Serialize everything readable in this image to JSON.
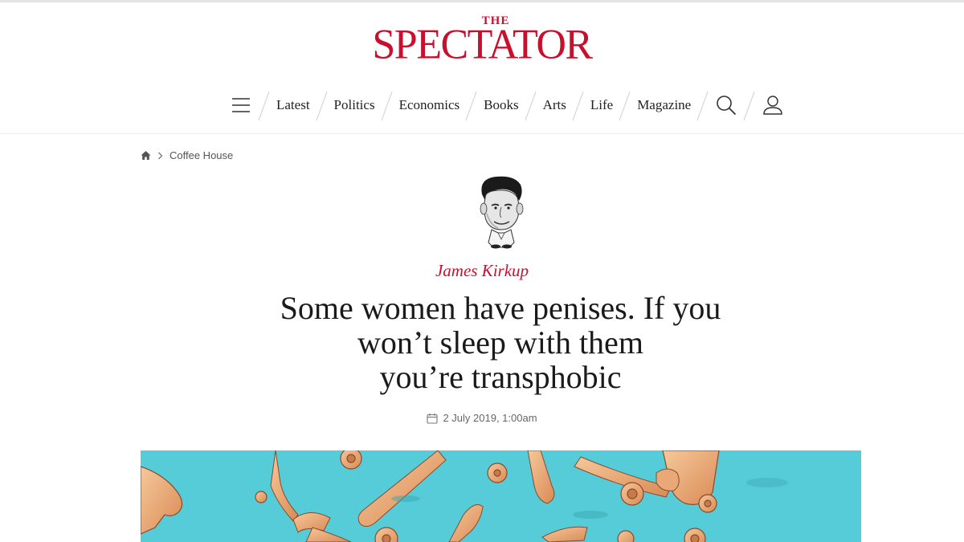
{
  "brand": {
    "logo_small": "THE",
    "logo_name": "SPECTATOR",
    "accent": "#c8102e"
  },
  "nav": {
    "menu_icon": "hamburger-menu-icon",
    "items": [
      "Latest",
      "Politics",
      "Economics",
      "Books",
      "Arts",
      "Life",
      "Magazine"
    ],
    "search_icon": "search-icon",
    "account_icon": "user-account-icon"
  },
  "breadcrumb": {
    "home_icon": "home-icon",
    "separator_icon": "chevron-right-icon",
    "section": "Coffee House"
  },
  "article": {
    "author": "James Kirkup",
    "headline_lines": [
      "Some women have penises. If you",
      "won’t sleep with them",
      "you’re transphobic"
    ],
    "date_icon": "calendar-icon",
    "date": "2 July 2019, 1:00am",
    "hero_background": "#56ccd8"
  }
}
